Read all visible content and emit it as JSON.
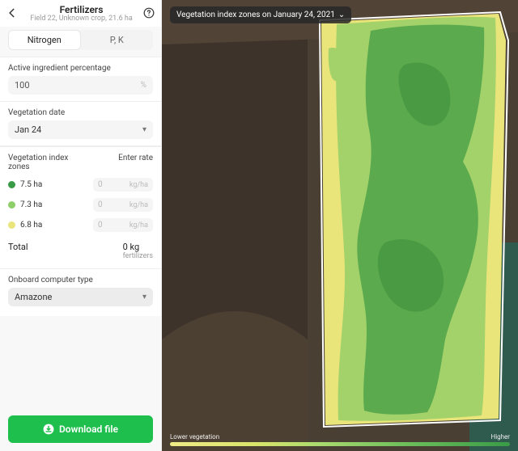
{
  "header": {
    "title": "Fertilizers",
    "subtitle": "Field 22, Unknown crop, 21.6 ha"
  },
  "tabs": {
    "nitrogen": "Nitrogen",
    "pk": "P, K"
  },
  "ingredient": {
    "label": "Active ingredient percentage",
    "value": "100",
    "unit": "%"
  },
  "vegdate": {
    "label": "Vegetation date",
    "value": "Jan 24"
  },
  "zones": {
    "head_left": "Vegetation index zones",
    "head_right": "Enter rate",
    "rate_placeholder": "0",
    "rate_unit": "kg/ha",
    "items": [
      {
        "size": "7.5 ha",
        "color": "#3a9b47"
      },
      {
        "size": "7.3 ha",
        "color": "#8fcf6a"
      },
      {
        "size": "6.8 ha",
        "color": "#e9e57a"
      }
    ]
  },
  "total": {
    "label": "Total",
    "value": "0 kg",
    "sub": "fertilizers"
  },
  "onboard": {
    "label": "Onboard computer type",
    "value": "Amazone"
  },
  "download": "Download file",
  "chip": "Vegetation index zones on January 24, 2021",
  "legend": {
    "low": "Lower vegetation",
    "high": "Higher"
  }
}
